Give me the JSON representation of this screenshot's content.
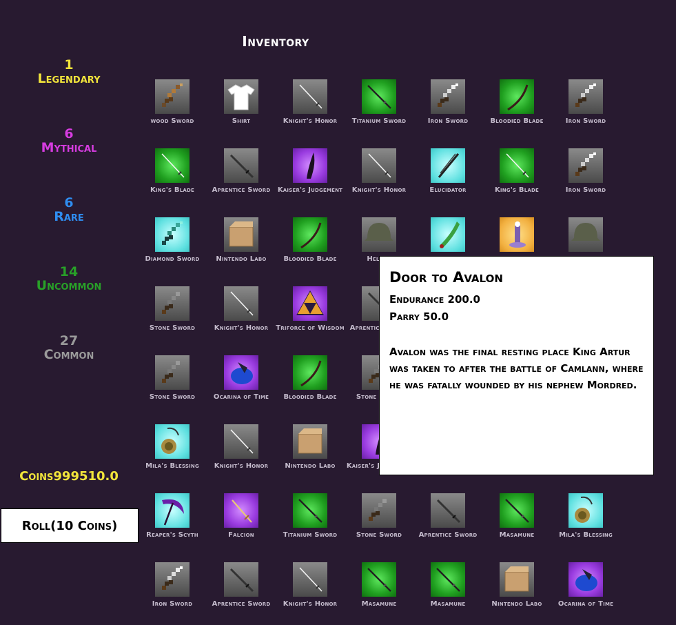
{
  "title": "Inventory",
  "rarities": [
    {
      "count": "1",
      "name": "Legendary",
      "color": "#f2e53b"
    },
    {
      "count": "6",
      "name": "Mythical",
      "color": "#d63ce0"
    },
    {
      "count": "6",
      "name": "Rare",
      "color": "#2f8df0"
    },
    {
      "count": "14",
      "name": "Uncommon",
      "color": "#28a028"
    },
    {
      "count": "27",
      "name": "Common",
      "color": "#9a9a9a"
    }
  ],
  "coins_label": "Coins999510.0",
  "roll_button": "Roll(10 Coins)",
  "items": [
    [
      {
        "label": "wood Sword",
        "icon": "pixel-sword-wood-icon",
        "bg": "common"
      },
      {
        "label": "Shirt",
        "icon": "shirt-icon",
        "bg": "common"
      },
      {
        "label": "Knight's Honor",
        "icon": "rapier-icon",
        "bg": "common"
      },
      {
        "label": "Titanium Sword",
        "icon": "katana-icon",
        "bg": "uncommon"
      },
      {
        "label": "Iron Sword",
        "icon": "pixel-sword-iron-icon",
        "bg": "common"
      },
      {
        "label": "Bloodied Blade",
        "icon": "curved-blade-icon",
        "bg": "uncommon"
      },
      {
        "label": "Iron Sword",
        "icon": "pixel-sword-iron-icon",
        "bg": "common"
      }
    ],
    [
      {
        "label": "King's Blade",
        "icon": "rapier-icon",
        "bg": "uncommon"
      },
      {
        "label": "Aprentice Sword",
        "icon": "longsword-icon",
        "bg": "common"
      },
      {
        "label": "Kaiser's Judgement",
        "icon": "dark-blade-icon",
        "bg": "mythical"
      },
      {
        "label": "Knight's Honor",
        "icon": "rapier-icon",
        "bg": "common"
      },
      {
        "label": "Elucidator",
        "icon": "dark-sword-icon",
        "bg": "rare"
      },
      {
        "label": "King's Blade",
        "icon": "rapier-icon",
        "bg": "uncommon"
      },
      {
        "label": "Iron Sword",
        "icon": "pixel-sword-iron-icon",
        "bg": "common"
      }
    ],
    [
      {
        "label": "Diamond Sword",
        "icon": "pixel-sword-diamond-icon",
        "bg": "rare"
      },
      {
        "label": "Nintendo Labo",
        "icon": "cardboard-box-icon",
        "bg": "common"
      },
      {
        "label": "Bloodied Blade",
        "icon": "curved-blade-icon",
        "bg": "uncommon"
      },
      {
        "label": "Helmet",
        "icon": "helmet-icon",
        "bg": "common"
      },
      {
        "label": "",
        "icon": "green-blade-icon",
        "bg": "rare"
      },
      {
        "label": "",
        "icon": "avalon-door-icon",
        "bg": "legendary"
      },
      {
        "label": "",
        "icon": "helmet-icon",
        "bg": "common"
      }
    ],
    [
      {
        "label": "Stone Sword",
        "icon": "pixel-sword-stone-icon",
        "bg": "common"
      },
      {
        "label": "Knight's Honor",
        "icon": "rapier-icon",
        "bg": "common"
      },
      {
        "label": "Triforce of Wisdom",
        "icon": "triforce-icon",
        "bg": "mythical"
      },
      {
        "label": "Aprentice Sword",
        "icon": "longsword-icon",
        "bg": "common"
      }
    ],
    [
      {
        "label": "Stone Sword",
        "icon": "pixel-sword-stone-icon",
        "bg": "common"
      },
      {
        "label": "Ocarina of Time",
        "icon": "ocarina-icon",
        "bg": "mythical"
      },
      {
        "label": "Bloodied Blade",
        "icon": "curved-blade-icon",
        "bg": "uncommon"
      },
      {
        "label": "Stone Sword",
        "icon": "pixel-sword-stone-icon",
        "bg": "common"
      }
    ],
    [
      {
        "label": "Mila's Blessing",
        "icon": "amulet-icon",
        "bg": "rare"
      },
      {
        "label": "Knight's Honor",
        "icon": "rapier-icon",
        "bg": "common"
      },
      {
        "label": "Nintendo Labo",
        "icon": "cardboard-box-icon",
        "bg": "common"
      },
      {
        "label": "Kaiser's Judgement",
        "icon": "dark-blade-icon",
        "bg": "mythical"
      }
    ],
    [
      {
        "label": "Reaper's Scyth",
        "icon": "scythe-icon",
        "bg": "rare"
      },
      {
        "label": "Falcion",
        "icon": "falchion-icon",
        "bg": "mythical"
      },
      {
        "label": "Titanium Sword",
        "icon": "katana-icon",
        "bg": "uncommon"
      },
      {
        "label": "Stone Sword",
        "icon": "pixel-sword-stone-icon",
        "bg": "common"
      },
      {
        "label": "Aprentice Sword",
        "icon": "longsword-icon",
        "bg": "common"
      },
      {
        "label": "Masamune",
        "icon": "katana-icon",
        "bg": "uncommon"
      },
      {
        "label": "Mila's Blessing",
        "icon": "amulet-icon",
        "bg": "rare"
      }
    ],
    [
      {
        "label": "Iron Sword",
        "icon": "pixel-sword-iron-icon",
        "bg": "common"
      },
      {
        "label": "Aprentice Sword",
        "icon": "longsword-icon",
        "bg": "common"
      },
      {
        "label": "Knight's Honor",
        "icon": "rapier-icon",
        "bg": "common"
      },
      {
        "label": "Masamune",
        "icon": "katana-icon",
        "bg": "uncommon"
      },
      {
        "label": "Masamune",
        "icon": "katana-icon",
        "bg": "uncommon"
      },
      {
        "label": "Nintendo Labo",
        "icon": "cardboard-box-icon",
        "bg": "common"
      },
      {
        "label": "Ocarina of Time",
        "icon": "ocarina-icon",
        "bg": "mythical"
      }
    ]
  ],
  "tooltip": {
    "name": "Door to Avalon",
    "stats": [
      "Endurance 200.0",
      "Parry 50.0"
    ],
    "description": "Avalon was the final resting place King Artur was taken to after the battle of Camlann, where he was fatally wounded by his nephew Mordred."
  }
}
